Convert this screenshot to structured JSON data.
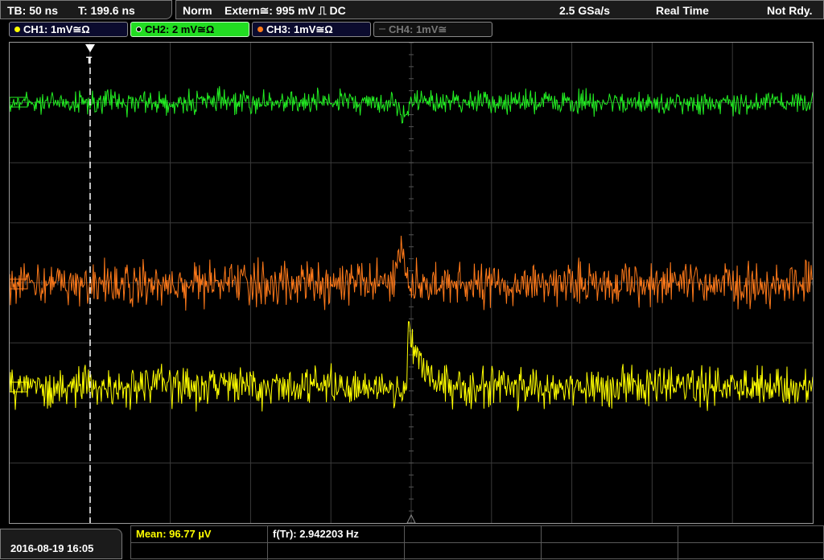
{
  "status_bar": {
    "tb": "TB: 50 ns",
    "t": "T: 199.6 ns",
    "mode": "Norm",
    "trigger": "Extern≅: 995 mV ⎍ DC",
    "sample_rate": "2.5 GSa/s",
    "acq_mode": "Real Time",
    "state": "Not Rdy."
  },
  "channels": [
    {
      "label": "CH1: 1mV≅Ω",
      "color": "#ffff00",
      "active": false
    },
    {
      "label": "CH2: 2 mV≅Ω",
      "color": "#22cc22",
      "active": true
    },
    {
      "label": "CH3: 1mV≅Ω",
      "color": "#ff7a1a",
      "active": false
    },
    {
      "label": "CH4: 1mV≅",
      "color": "#777777",
      "active": false
    }
  ],
  "markers": {
    "trigger_label": "T"
  },
  "bottom": {
    "datetime": "2016-08-19 16:05",
    "mean": "Mean: 96.77 µV",
    "freq": "f(Tr): 2.942203 Hz"
  },
  "colors": {
    "ch1": "#ffff00",
    "ch2": "#22ee22",
    "ch3": "#ff7a1a",
    "ch4": "#777777",
    "grid": "#3a3a3a",
    "trigger_line": "#ffffff"
  }
}
